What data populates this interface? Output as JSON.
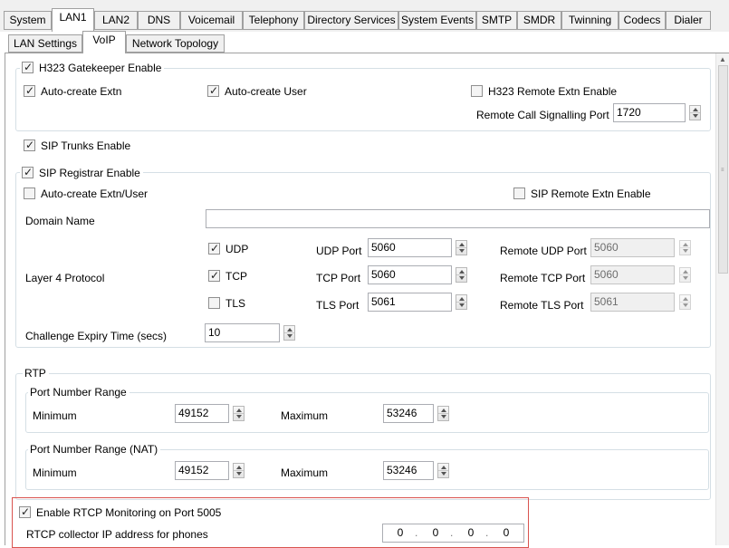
{
  "main_tabs": [
    "System",
    "LAN1",
    "LAN2",
    "DNS",
    "Voicemail",
    "Telephony",
    "Directory Services",
    "System Events",
    "SMTP",
    "SMDR",
    "Twinning",
    "Codecs",
    "Dialer"
  ],
  "sub_tabs": [
    "LAN Settings",
    "VoIP",
    "Network Topology"
  ],
  "h323": {
    "gatekeeper_enable": "H323 Gatekeeper Enable",
    "auto_create_extn": "Auto-create Extn",
    "auto_create_user": "Auto-create User",
    "remote_extn_enable": "H323 Remote Extn Enable",
    "remote_call_signalling_port_label": "Remote Call Signalling Port",
    "remote_call_signalling_port": "1720"
  },
  "sip_trunks_enable": "SIP Trunks Enable",
  "sip_registrar": {
    "enable": "SIP Registrar Enable",
    "auto_create_extn_user": "Auto-create Extn/User",
    "remote_extn_enable": "SIP Remote Extn Enable",
    "domain_name_label": "Domain Name",
    "domain_name": "",
    "layer4_label": "Layer 4 Protocol",
    "udp": "UDP",
    "tcp": "TCP",
    "tls": "TLS",
    "udp_port_label": "UDP Port",
    "tcp_port_label": "TCP Port",
    "tls_port_label": "TLS Port",
    "udp_port": "5060",
    "tcp_port": "5060",
    "tls_port": "5061",
    "remote_udp_port_label": "Remote UDP Port",
    "remote_tcp_port_label": "Remote TCP Port",
    "remote_tls_port_label": "Remote TLS Port",
    "remote_udp_port": "5060",
    "remote_tcp_port": "5060",
    "remote_tls_port": "5061",
    "challenge_expiry_label": "Challenge Expiry Time (secs)",
    "challenge_expiry": "10"
  },
  "rtp": {
    "legend": "RTP",
    "port_range": {
      "legend": "Port Number Range",
      "minimum_label": "Minimum",
      "maximum_label": "Maximum",
      "minimum": "49152",
      "maximum": "53246"
    },
    "port_range_nat": {
      "legend": "Port Number Range (NAT)",
      "minimum_label": "Minimum",
      "maximum_label": "Maximum",
      "minimum": "49152",
      "maximum": "53246"
    }
  },
  "rtcp": {
    "enable_label": "Enable RTCP Monitoring on Port 5005",
    "collector_label": "RTCP collector IP address for phones",
    "ip": [
      "0",
      "0",
      "0",
      "0"
    ]
  }
}
